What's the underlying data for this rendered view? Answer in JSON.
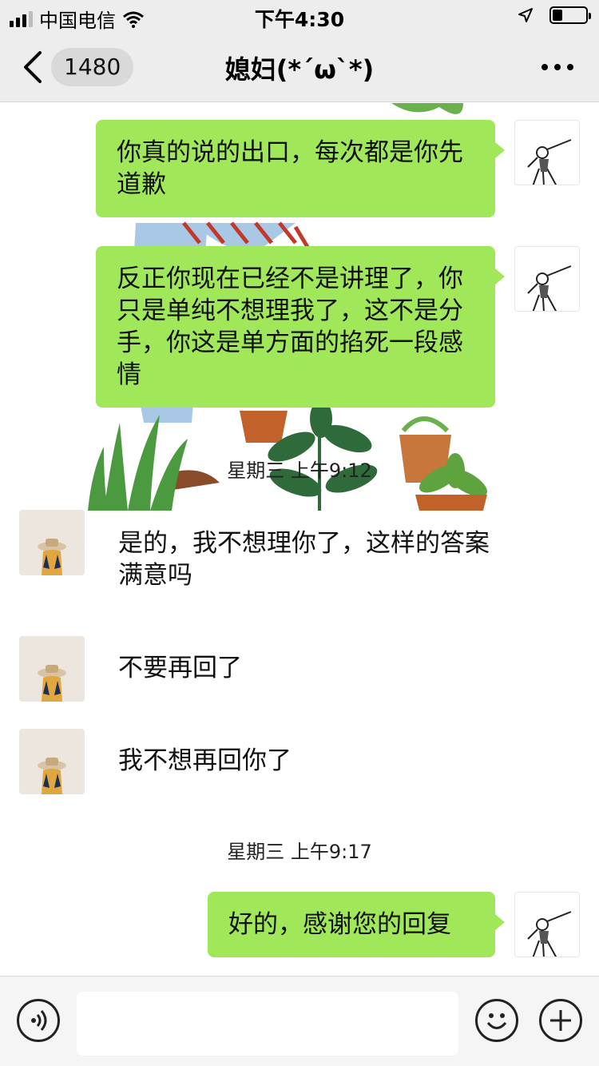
{
  "status_bar": {
    "carrier": "中国电信",
    "time": "下午4:30"
  },
  "nav": {
    "unread_count": "1480",
    "title": "媳妇(*´ω`*)"
  },
  "messages": [
    {
      "id": "m1",
      "sender": "me",
      "text": "你真的说的出口，每次都是你先道歉"
    },
    {
      "id": "m2",
      "sender": "me",
      "text": "反正你现在已经不是讲理了，你只是单纯不想理我了，这不是分手，你这是单方面的掐死一段感情"
    },
    {
      "id": "t1",
      "type": "timestamp",
      "text": "星期三 上午9:12"
    },
    {
      "id": "m3",
      "sender": "her",
      "text": "是的，我不想理你了，这样的答案满意吗"
    },
    {
      "id": "m4",
      "sender": "her",
      "text": "不要再回了"
    },
    {
      "id": "m5",
      "sender": "her",
      "text": "我不想再回你了"
    },
    {
      "id": "t2",
      "type": "timestamp",
      "text": "星期三 上午9:17"
    },
    {
      "id": "m6",
      "sender": "me",
      "text": "好的，感谢您的回复"
    }
  ],
  "input": {
    "value": ""
  },
  "colors": {
    "bubble_green": "#a0e75a",
    "nav_bg": "#ededed"
  }
}
